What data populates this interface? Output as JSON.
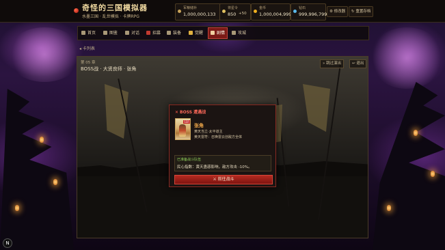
{
  "header": {
    "title": "奇怪的三国模拟器",
    "subtitle": "水墨三国 · 乱世模拟 · 卡牌RPG",
    "stats": [
      {
        "label": "军粮储补",
        "value": "1,000,000,133",
        "icon": "grain-icon",
        "color": "#c9a55a"
      },
      {
        "label": "将星令",
        "value": "850",
        "extra": "+50",
        "icon": "star-icon",
        "color": "#e0c060"
      },
      {
        "label": "金币",
        "value": "1,000,004,999",
        "icon": "gold-coin-icon",
        "color": "#f0b020"
      },
      {
        "label": "钻石",
        "value": "999,996,799",
        "icon": "diamond-icon",
        "color": "#5ab8e8"
      }
    ],
    "buttons": {
      "modify": "⚙ 修改器",
      "reset": "↻ 重置存档"
    }
  },
  "nav": {
    "items": [
      {
        "label": "首页",
        "icon": "home-icon",
        "active": false
      },
      {
        "label": "图鉴",
        "icon": "book-icon",
        "active": false
      },
      {
        "label": "对话",
        "icon": "chat-icon",
        "active": false
      },
      {
        "label": "招募",
        "icon": "recruit-icon",
        "active": false
      },
      {
        "label": "装备",
        "icon": "equipment-icon",
        "active": false
      },
      {
        "label": "觉醒",
        "icon": "awaken-icon",
        "active": false
      },
      {
        "label": "剧情",
        "icon": "story-icon",
        "active": true
      },
      {
        "label": "攻城",
        "icon": "siege-icon",
        "active": false
      }
    ]
  },
  "breadcrumb": "卡列表",
  "stage": {
    "chapter": "第 05 章",
    "title": "BOSS战 · 大贤良师 · 张角",
    "buttons": {
      "auto": "» 跳过演出",
      "exit": "↩ 退出"
    }
  },
  "boss_dialog": {
    "title": "BOSS 遭遇战",
    "card_badge": "SSR",
    "general_name": "张角",
    "general_line1": "黄天当立·太平道主",
    "general_line2": "黄天雷符：召唤雷云创敌方全体",
    "tip_head": "已准备战斗队伍",
    "tip_body": "民心指数：黄天蛊惑影响，敌方攻击 -10%。",
    "action": "⚔ 前往战斗"
  },
  "corner_badge": "N",
  "colors": {
    "accent_red": "#b52a20",
    "gold": "#f0d9a0",
    "panel_bg": "#1b1412"
  }
}
